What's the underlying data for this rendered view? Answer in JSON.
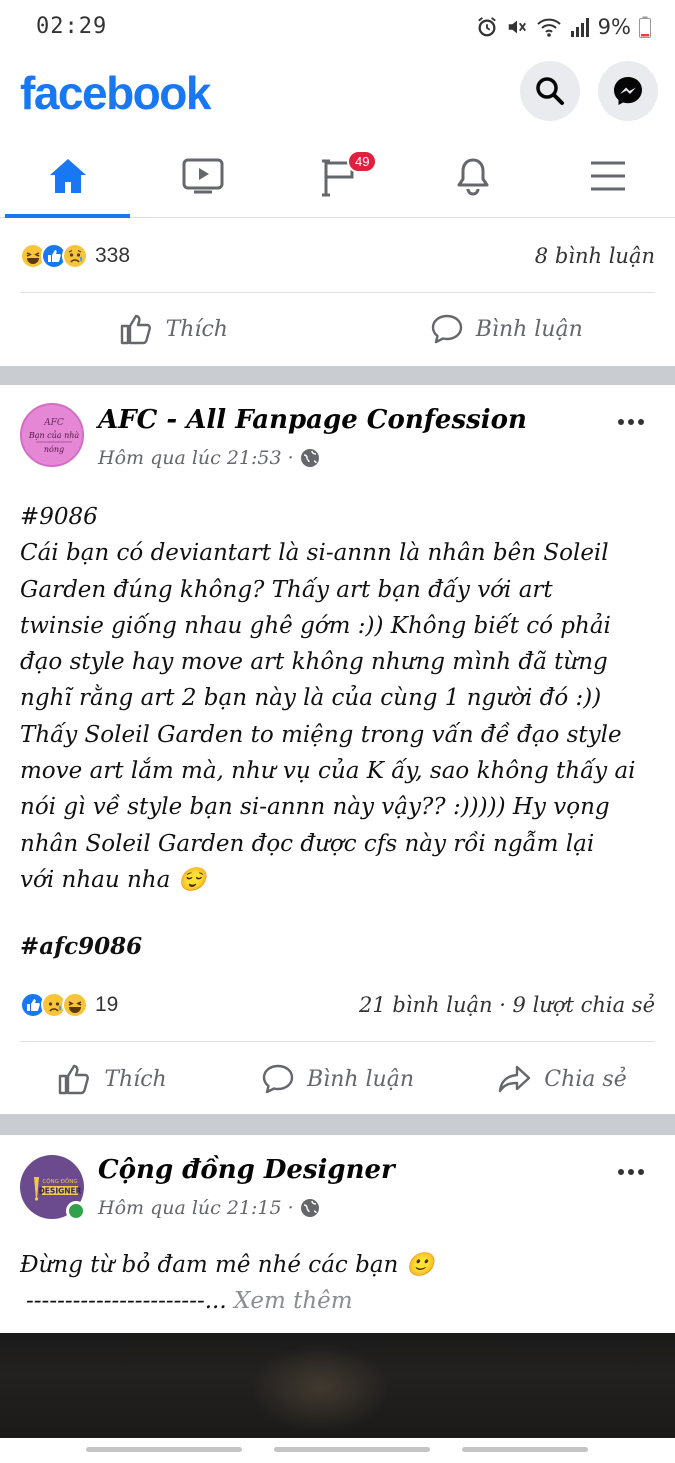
{
  "status_bar": {
    "time": "02:29",
    "battery_percent": "9%"
  },
  "header": {
    "logo": "facebook",
    "search_icon": "search-icon",
    "messenger_icon": "messenger-icon"
  },
  "nav": {
    "tabs": [
      {
        "name": "home",
        "icon": "home-icon",
        "active": true
      },
      {
        "name": "watch",
        "icon": "video-icon",
        "active": false
      },
      {
        "name": "pages",
        "icon": "flag-icon",
        "active": false,
        "badge": "49"
      },
      {
        "name": "notifications",
        "icon": "bell-icon",
        "active": false
      },
      {
        "name": "menu",
        "icon": "menu-icon",
        "active": false
      }
    ]
  },
  "post_prev": {
    "reaction_count": "338",
    "comments": "8 bình luận",
    "actions": {
      "like": "Thích",
      "comment": "Bình luận"
    }
  },
  "post_afc": {
    "author": "AFC - All Fanpage Confession",
    "time": "Hôm qua lúc 21:53 ·",
    "body": "#9086\nCái bạn có deviantart là si-annn là nhân bên Soleil\nGarden đúng không? Thấy art bạn đấy với art\ntwinsie giống nhau ghê gớm :)) Không biết có phải\nđạo style hay move art không nhưng mình đã từng\nnghĩ rằng art 2 bạn này là của cùng 1 người đó :))\nThấy Soleil Garden to miệng trong vấn đề đạo style\nmove art lắm mà, như vụ của K ấy, sao không thấy ai\nnói gì về style bạn si-annn này vậy?? :))))) Hy vọng\nnhân Soleil Garden đọc được cfs này rồi ngẫm lại\nvới nhau nha 😌",
    "hashtag": "#afc9086",
    "reaction_count": "19",
    "meta": "21 bình luận · 9 lượt chia sẻ",
    "actions": {
      "like": "Thích",
      "comment": "Bình luận",
      "share": "Chia sẻ"
    },
    "avatar_text": {
      "line1": "AFC",
      "line2": "Bạn của nhà",
      "line3": "nóng"
    }
  },
  "post_designer": {
    "author": "Cộng đồng Designer",
    "time": "Hôm qua lúc 21:15 ·",
    "body": "Đừng từ bỏ đam mê nhé các bạn 🙂",
    "dashes": "-----------------------...",
    "see_more": "Xem thêm",
    "avatar_text": {
      "line1": "CỘNG ĐỒNG",
      "line2": "DESIGNER"
    }
  },
  "colors": {
    "brand": "#1877f2",
    "badge": "#e41e3f",
    "separator": "#c9ccd1",
    "online": "#31a24c"
  }
}
